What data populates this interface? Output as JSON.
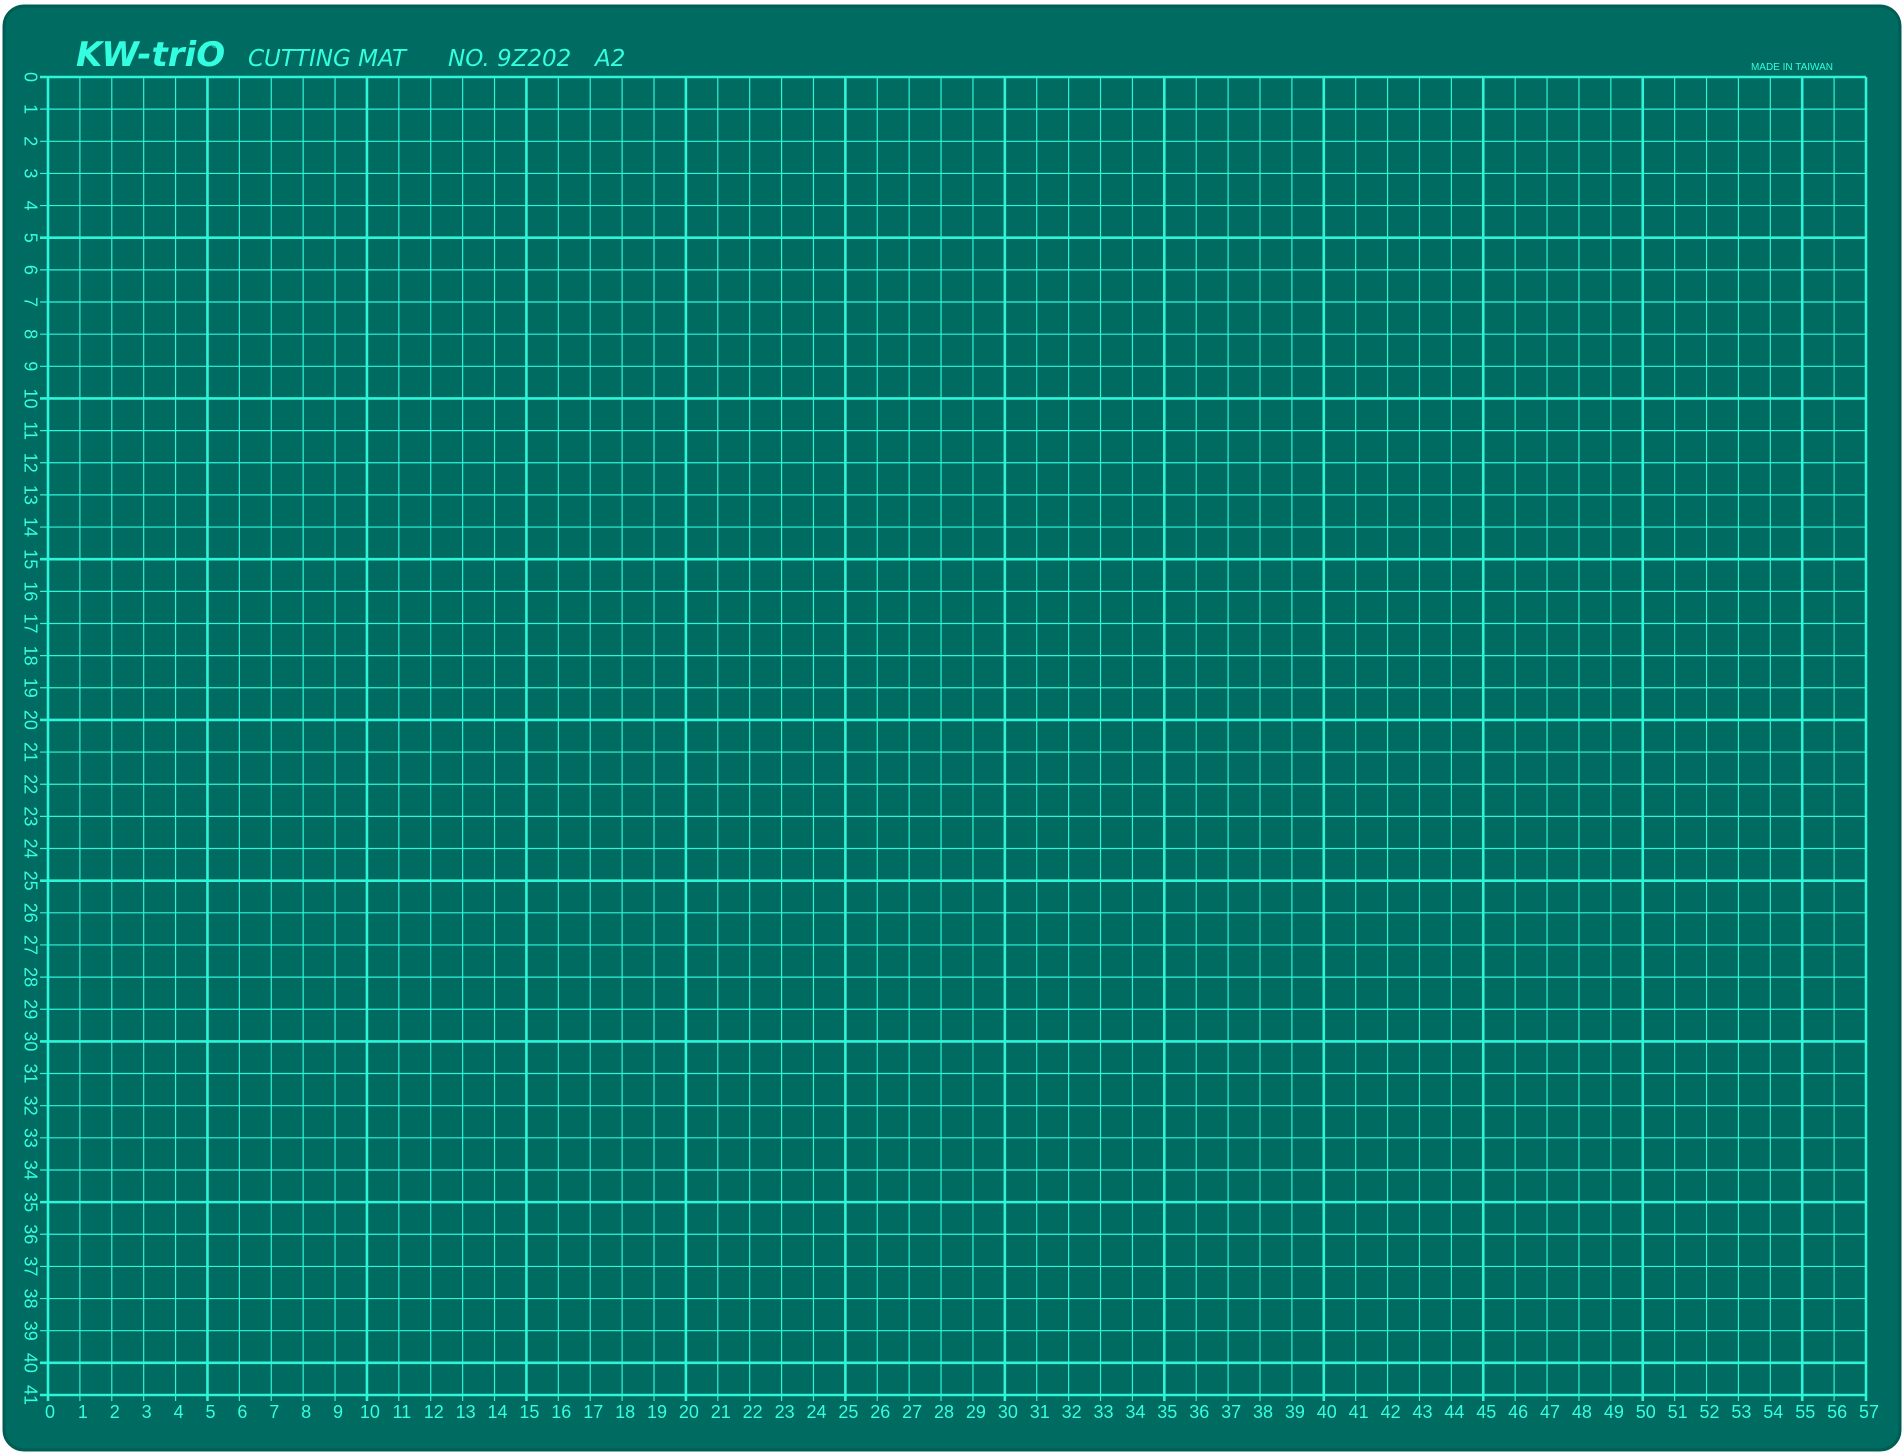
{
  "mat": {
    "brand": "KW-triO",
    "registered_mark": "®",
    "product": "CUTTING MAT",
    "model": "NO. 9Z202",
    "size": "A2",
    "origin": "MADE IN TAIWAN",
    "unit": "cm",
    "columns": 57,
    "rows": 41,
    "major_line_every": 5,
    "colors": {
      "surface": "#006b60",
      "surface_edge": "#005d54",
      "grid_line": "#2ef5d8",
      "print": "#33ffe0"
    }
  },
  "scales": {
    "bottom": [
      "0",
      "1",
      "2",
      "3",
      "4",
      "5",
      "6",
      "7",
      "8",
      "9",
      "10",
      "11",
      "12",
      "13",
      "14",
      "15",
      "16",
      "17",
      "18",
      "19",
      "20",
      "21",
      "22",
      "23",
      "24",
      "25",
      "26",
      "27",
      "28",
      "29",
      "30",
      "31",
      "32",
      "33",
      "34",
      "35",
      "36",
      "37",
      "38",
      "39",
      "40",
      "41",
      "42",
      "43",
      "44",
      "45",
      "46",
      "47",
      "48",
      "49",
      "50",
      "51",
      "52",
      "53",
      "54",
      "55",
      "56",
      "57"
    ],
    "left": [
      "0",
      "1",
      "2",
      "3",
      "4",
      "5",
      "6",
      "7",
      "8",
      "9",
      "10",
      "11",
      "12",
      "13",
      "14",
      "15",
      "16",
      "17",
      "18",
      "19",
      "20",
      "21",
      "22",
      "23",
      "24",
      "25",
      "26",
      "27",
      "28",
      "29",
      "30",
      "31",
      "32",
      "33",
      "34",
      "35",
      "36",
      "37",
      "38",
      "39",
      "40",
      "41"
    ]
  }
}
